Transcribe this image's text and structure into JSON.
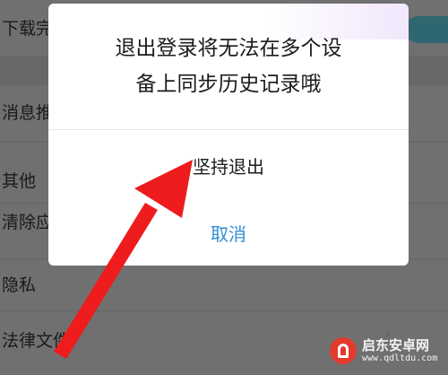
{
  "background_settings": {
    "rows": [
      {
        "label": "下载完"
      },
      {
        "label": "消息推"
      },
      {
        "label": "其他"
      },
      {
        "label": "清除应"
      },
      {
        "label": "隐私"
      },
      {
        "label": "法律文件"
      }
    ],
    "toggle_state": "on",
    "toggle_color": "#2f6770"
  },
  "dialog": {
    "message_line1": "退出登录将无法在多个设",
    "message_line2": "备上同步历史记录哦",
    "confirm_label": "坚持退出",
    "cancel_label": "取消",
    "cancel_color": "#2f8fd0"
  },
  "annotation": {
    "arrow_color": "#ee1c1c"
  },
  "watermark": {
    "title": "启东安卓网",
    "url": "www.qdltdu.com"
  }
}
